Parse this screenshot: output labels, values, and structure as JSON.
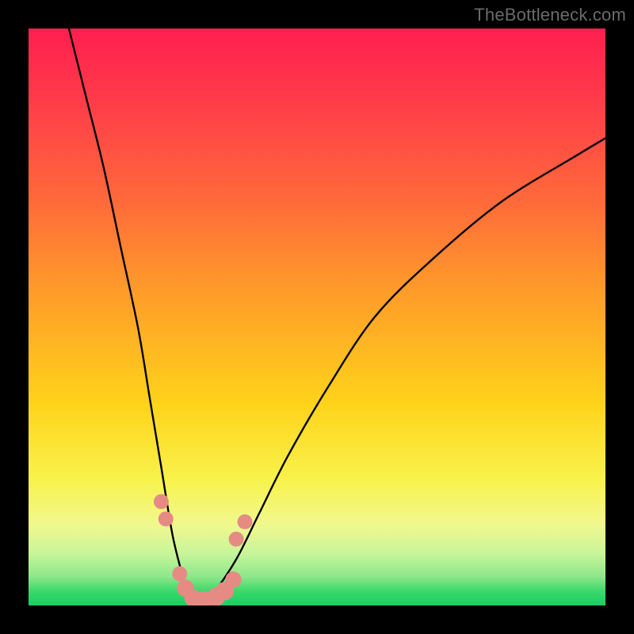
{
  "watermark": "TheBottleneck.com",
  "chart_data": {
    "type": "line",
    "title": "",
    "xlabel": "",
    "ylabel": "",
    "xlim": [
      0,
      100
    ],
    "ylim": [
      0,
      100
    ],
    "grid": false,
    "legend": false,
    "series": [
      {
        "name": "bottleneck-curve",
        "x": [
          7,
          10,
          13,
          16,
          19,
          21,
          23,
          25,
          27,
          28,
          30,
          32,
          36,
          40,
          45,
          52,
          60,
          70,
          82,
          95,
          100
        ],
        "values": [
          100,
          88,
          76,
          62,
          48,
          36,
          24,
          12,
          4,
          0,
          0,
          2,
          8,
          16,
          26,
          38,
          50,
          60,
          70,
          78,
          81
        ]
      }
    ],
    "markers": [
      {
        "name": "left-upper-1",
        "x": 23.0,
        "y": 18.0,
        "r": 1.3
      },
      {
        "name": "left-upper-2",
        "x": 23.8,
        "y": 15.0,
        "r": 1.3
      },
      {
        "name": "left-lower-1",
        "x": 26.2,
        "y": 5.5,
        "r": 1.3
      },
      {
        "name": "left-lower-2",
        "x": 27.2,
        "y": 3.0,
        "r": 1.5
      },
      {
        "name": "trough-1",
        "x": 28.5,
        "y": 1.3,
        "r": 1.5
      },
      {
        "name": "trough-2",
        "x": 30.5,
        "y": 1.0,
        "r": 1.5
      },
      {
        "name": "trough-3",
        "x": 32.5,
        "y": 1.5,
        "r": 1.6
      },
      {
        "name": "trough-4",
        "x": 34.0,
        "y": 2.5,
        "r": 1.6
      },
      {
        "name": "right-lower-1",
        "x": 35.5,
        "y": 4.5,
        "r": 1.4
      },
      {
        "name": "right-upper-1",
        "x": 36.0,
        "y": 11.5,
        "r": 1.3
      },
      {
        "name": "right-upper-2",
        "x": 37.5,
        "y": 14.5,
        "r": 1.3
      }
    ],
    "colors": {
      "curve": "#000000",
      "markers": "#e58b84"
    }
  }
}
